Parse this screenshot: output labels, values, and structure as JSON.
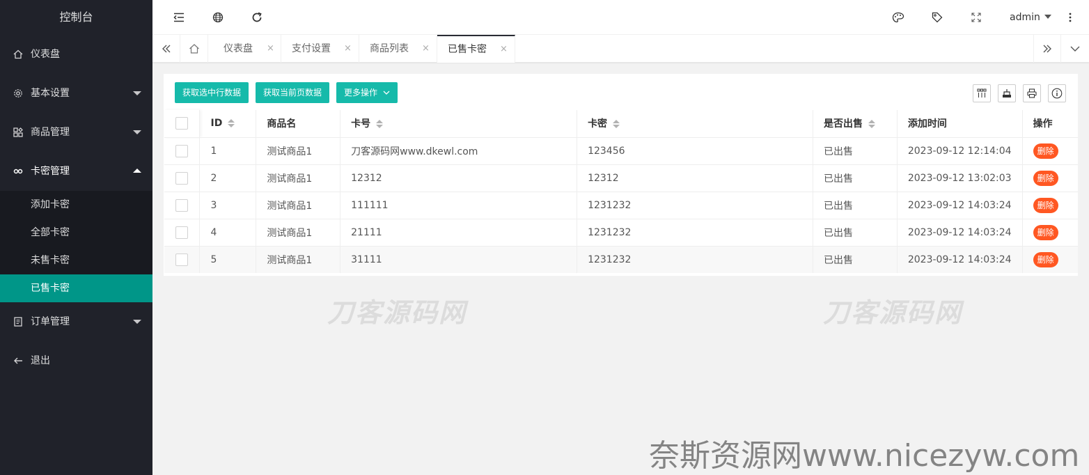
{
  "sidebar": {
    "title": "控制台",
    "items": [
      {
        "label": "仪表盘"
      },
      {
        "label": "基本设置"
      },
      {
        "label": "商品管理"
      },
      {
        "label": "卡密管理"
      },
      {
        "label": "订单管理"
      },
      {
        "label": "退出"
      }
    ],
    "sub_items": [
      {
        "label": "添加卡密"
      },
      {
        "label": "全部卡密"
      },
      {
        "label": "未售卡密"
      },
      {
        "label": "已售卡密"
      }
    ]
  },
  "header": {
    "user": "admin"
  },
  "tabs": [
    {
      "label": "仪表盘",
      "close": "×"
    },
    {
      "label": "支付设置",
      "close": "×"
    },
    {
      "label": "商品列表",
      "close": "×"
    },
    {
      "label": "已售卡密",
      "close": "×"
    }
  ],
  "toolbar": {
    "get_checked": "获取选中行数据",
    "get_page": "获取当前页数据",
    "more": "更多操作"
  },
  "table": {
    "columns": [
      "ID",
      "商品名",
      "卡号",
      "卡密",
      "是否出售",
      "添加时间",
      "操作"
    ],
    "rows": [
      {
        "id": "1",
        "name": "测试商品1",
        "card_no": "刀客源码网www.dkewl.com",
        "secret": "123456",
        "sold": "已出售",
        "time": "2023-09-12 12:14:04",
        "action": "删除"
      },
      {
        "id": "2",
        "name": "测试商品1",
        "card_no": "12312",
        "secret": "12312",
        "sold": "已出售",
        "time": "2023-09-12 13:02:03",
        "action": "删除"
      },
      {
        "id": "3",
        "name": "测试商品1",
        "card_no": "111111",
        "secret": "1231232",
        "sold": "已出售",
        "time": "2023-09-12 14:03:24",
        "action": "删除"
      },
      {
        "id": "4",
        "name": "测试商品1",
        "card_no": "21111",
        "secret": "1231232",
        "sold": "已出售",
        "time": "2023-09-12 14:03:24",
        "action": "删除"
      },
      {
        "id": "5",
        "name": "测试商品1",
        "card_no": "31111",
        "secret": "1231232",
        "sold": "已出售",
        "time": "2023-09-12 14:03:24",
        "action": "删除"
      }
    ]
  },
  "watermarks": {
    "brand": "刀客源码网",
    "site": "奈斯资源网www.nicezyw.com"
  },
  "colors": {
    "sidebar_bg": "#20222a",
    "active_menu": "#009688",
    "button": "#16baaa",
    "delete": "#ff5722"
  }
}
